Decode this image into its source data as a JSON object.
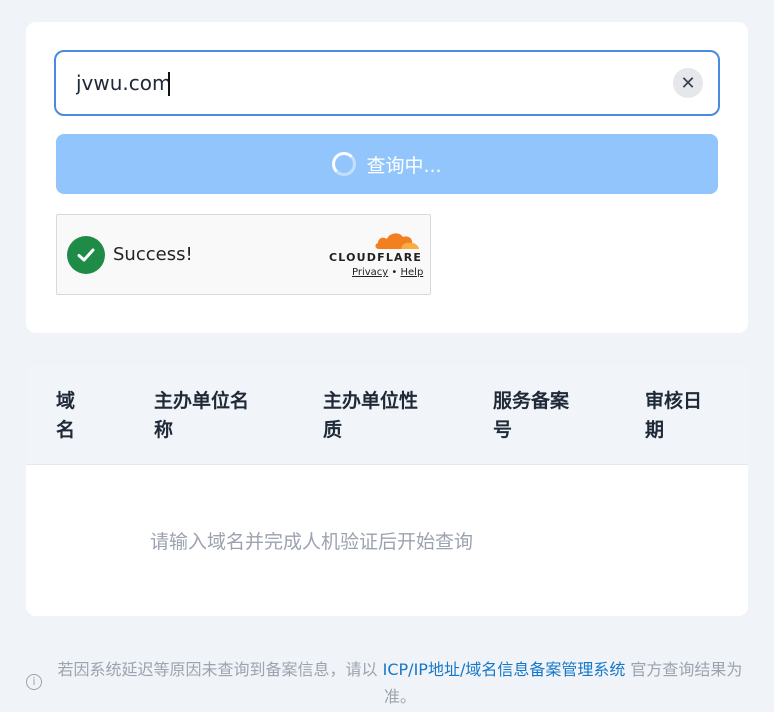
{
  "search": {
    "value": "jvwu.com",
    "clear_icon": "close-icon",
    "button_label": "查询中..."
  },
  "captcha": {
    "status": "Success!",
    "brand": "CLOUDFLARE",
    "privacy": "Privacy",
    "separator": "•",
    "help": "Help"
  },
  "table": {
    "headers": [
      "域名",
      "主办单位名称",
      "主办单位性质",
      "服务备案号",
      "审核日期"
    ],
    "empty_text": "请输入域名并完成人机验证后开始查询"
  },
  "footer": {
    "text_before": "若因系统延迟等原因未查询到备案信息，请以 ",
    "link_text": "ICP/IP地址/域名信息备案管理系统",
    "text_after": " 官方查询结果为准。"
  },
  "colors": {
    "accent": "#4a8be0",
    "button_loading": "#93c5fd",
    "success_green": "#1e8b47",
    "link": "#1677c7"
  }
}
